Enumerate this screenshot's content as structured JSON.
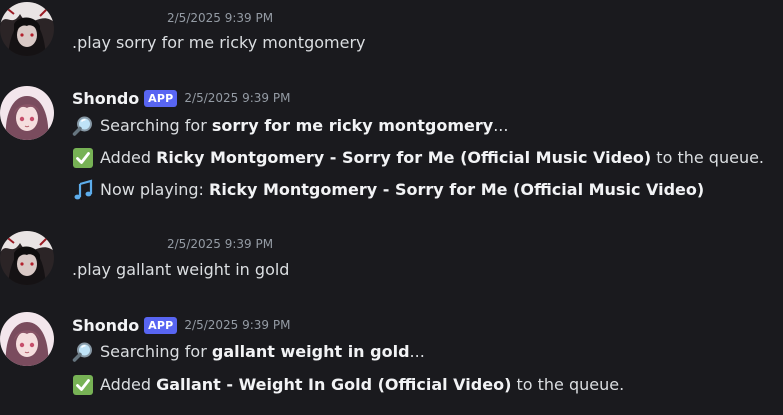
{
  "messages": [
    {
      "timestamp": "2/5/2025 9:39 PM",
      "text": ".play sorry for me ricky montgomery"
    },
    {
      "author": "Shondo",
      "badge": "APP",
      "timestamp": "2/5/2025 9:39 PM",
      "lines": [
        {
          "icon": "magnifier-icon",
          "prefix": "Searching for ",
          "bold": "sorry for me ricky montgomery",
          "suffix": "..."
        },
        {
          "icon": "check-mark-icon",
          "prefix": "Added ",
          "bold": "Ricky Montgomery - Sorry for Me (Official Music Video)",
          "suffix": " to the queue."
        },
        {
          "icon": "music-notes-icon",
          "prefix": "Now playing: ",
          "bold": "Ricky Montgomery - Sorry for Me (Official Music Video)",
          "suffix": ""
        }
      ]
    },
    {
      "timestamp": "2/5/2025 9:39 PM",
      "text": ".play gallant weight in gold"
    },
    {
      "author": "Shondo",
      "badge": "APP",
      "timestamp": "2/5/2025 9:39 PM",
      "lines": [
        {
          "icon": "magnifier-icon",
          "prefix": "Searching for ",
          "bold": "gallant weight in gold",
          "suffix": "..."
        },
        {
          "icon": "check-mark-icon",
          "prefix": "Added ",
          "bold": "Gallant - Weight In Gold (Official Video)",
          "suffix": " to the queue."
        }
      ]
    }
  ],
  "colors": {
    "background": "#1a1a1e",
    "badge": "#5865f2",
    "text": "#dbdee1",
    "timestamp": "#949ba4",
    "check": "#77b255"
  }
}
